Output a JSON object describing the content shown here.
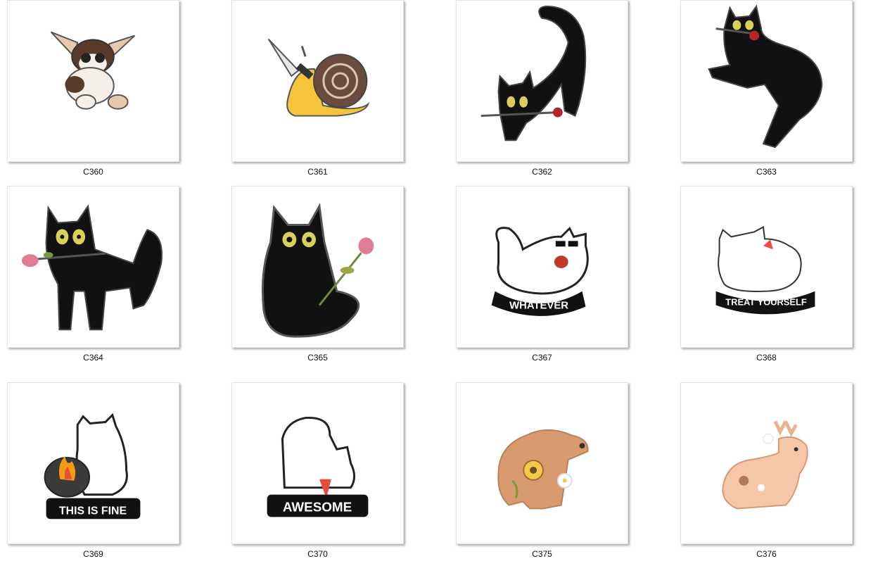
{
  "thumbnails": [
    {
      "label": "C360",
      "icon": "gremlin-pin-icon"
    },
    {
      "label": "C361",
      "icon": "snail-knife-pin-icon"
    },
    {
      "label": "C362",
      "icon": "black-cat-rose-pin-icon"
    },
    {
      "label": "C363",
      "icon": "black-cat-rose-pin-icon"
    },
    {
      "label": "C364",
      "icon": "black-cat-rose-pin-icon"
    },
    {
      "label": "C365",
      "icon": "black-cat-rose-pin-icon"
    },
    {
      "label": "C367",
      "icon": "white-cat-sunglasses-pin-icon",
      "caption": "WHATEVER"
    },
    {
      "label": "C368",
      "icon": "white-cat-pin-icon",
      "caption": "TREAT YOURSELF"
    },
    {
      "label": "C369",
      "icon": "white-cat-fire-pin-icon",
      "caption": "THIS IS FINE"
    },
    {
      "label": "C370",
      "icon": "white-cat-stretch-pin-icon",
      "caption": "AWESOME"
    },
    {
      "label": "C375",
      "icon": "capybara-flowers-pin-icon"
    },
    {
      "label": "C376",
      "icon": "deer-flowers-pin-icon"
    }
  ]
}
